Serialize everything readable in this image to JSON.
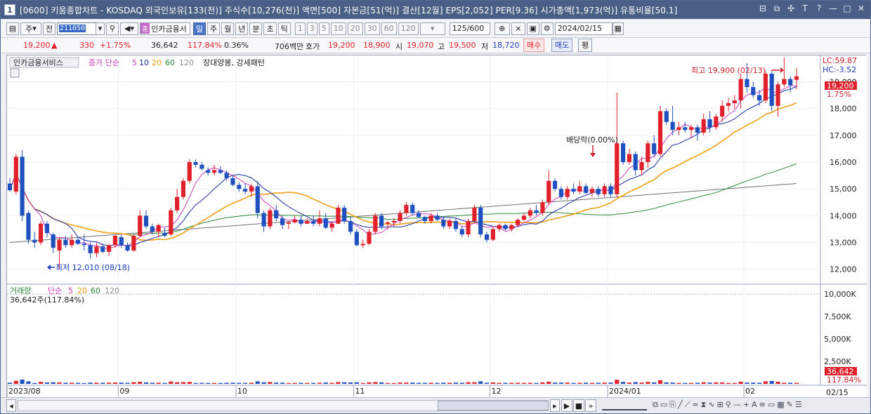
{
  "window": {
    "number": "1",
    "title": "[0600] 키움종합차트 - KOSDAQ 외국인보유[133(천)] 주식수[10,276(천)] 액면[500] 자본금[51(억)] 결산[12월] EPS[2,052] PER[9.36] 시가총액[1,973(억)] 유통비율[50.1]",
    "controls": [
      "⊟",
      "⧉",
      "✣",
      "T",
      "?",
      "—",
      "□",
      "✕"
    ]
  },
  "toolbar": {
    "type_select": "주",
    "prev_label": "전",
    "code": "211050",
    "stock_name": "인카금융서",
    "name_tag": "종",
    "periods": [
      "일",
      "주",
      "월",
      "년",
      "분",
      "초",
      "틱"
    ],
    "active_period": "일",
    "intervals": [
      "1",
      "3",
      "5",
      "10",
      "20",
      "30",
      "60",
      "120"
    ],
    "count": "125",
    "count_max": "/600",
    "date": "2024/02/15"
  },
  "quote": {
    "price": "19,200",
    "arrow": "▲",
    "change": "330",
    "change_pct": "+1.75%",
    "volume": "36,642",
    "vol_ratio": "117.84%",
    "turnover": "0.36%",
    "amount": "706백만",
    "ask_label": "호가",
    "ask": "19,200",
    "bid": "18,900",
    "open_label": "시",
    "open": "19,070",
    "high_label": "고",
    "high": "19,500",
    "low_label": "저",
    "low": "18,720",
    "buy": "매수",
    "sell": "매도",
    "eval": "평"
  },
  "price_pane": {
    "legend_name": "인카금융서비스",
    "legend_ma": "종가 단순",
    "ma_periods": [
      "5",
      "10",
      "20",
      "60",
      "120"
    ],
    "pattern": "장대양봉, 강세패턴",
    "lc": "LC:59.87",
    "hc": "HC:-3.52",
    "last_price": "19,200",
    "last_pct": "1.75%",
    "high_note": "최고 19,900 (02/13)",
    "low_note": "최저 12,010 (08/18)",
    "event_note": "배당락(0.00%)",
    "y_ticks": [
      "19,000",
      "18,000",
      "17,000",
      "16,000",
      "15,000",
      "14,000",
      "13,000",
      "12,000"
    ]
  },
  "volume_pane": {
    "legend_name": "거래량",
    "legend_ma": "단순",
    "ma_periods": [
      "5",
      "20",
      "60",
      "120"
    ],
    "summary": "36,642주(117.84%)",
    "y_ticks": [
      "10,000K",
      "7,500K",
      "5,000K",
      "2,500K"
    ],
    "last_volume": "36,642",
    "last_pct": "117.84%"
  },
  "x_labels": [
    "2023/08",
    "09",
    "10",
    "11",
    "12",
    "2024/01",
    "02"
  ],
  "x_end_label": "02/15",
  "colors": {
    "up": "#e0202a",
    "down": "#1e50c0",
    "ma5": "#d040c0",
    "ma10": "#1a2aa0",
    "ma20": "#f0a018",
    "ma60": "#2a8a3a",
    "ma120": "#707070"
  },
  "chart_data": {
    "type": "candlestick",
    "y_range": [
      11600,
      19850
    ],
    "candles": [
      {
        "d": "08/07",
        "o": 15200,
        "h": 15400,
        "l": 14900,
        "c": 14950
      },
      {
        "d": "08/08",
        "o": 14900,
        "h": 16300,
        "l": 14800,
        "c": 16200
      },
      {
        "d": "08/09",
        "o": 16200,
        "h": 16450,
        "l": 13800,
        "c": 14000
      },
      {
        "d": "08/10",
        "o": 14100,
        "h": 14200,
        "l": 12950,
        "c": 13100
      },
      {
        "d": "08/11",
        "o": 13100,
        "h": 13400,
        "l": 12800,
        "c": 13000
      },
      {
        "d": "08/14",
        "o": 13000,
        "h": 13800,
        "l": 12900,
        "c": 13700
      },
      {
        "d": "08/16",
        "o": 13700,
        "h": 13800,
        "l": 13200,
        "c": 13350
      },
      {
        "d": "08/17",
        "o": 13300,
        "h": 13350,
        "l": 12600,
        "c": 12800
      },
      {
        "d": "08/18",
        "o": 12700,
        "h": 13200,
        "l": 12010,
        "c": 13100
      },
      {
        "d": "08/21",
        "o": 13100,
        "h": 13250,
        "l": 12800,
        "c": 12900
      },
      {
        "d": "08/22",
        "o": 12900,
        "h": 13300,
        "l": 12800,
        "c": 13100
      },
      {
        "d": "08/23",
        "o": 13100,
        "h": 13200,
        "l": 12900,
        "c": 12950
      },
      {
        "d": "08/24",
        "o": 12950,
        "h": 13300,
        "l": 12700,
        "c": 12900
      },
      {
        "d": "08/25",
        "o": 12900,
        "h": 13000,
        "l": 12400,
        "c": 12600
      },
      {
        "d": "08/28",
        "o": 12600,
        "h": 13000,
        "l": 12450,
        "c": 12850
      },
      {
        "d": "08/29",
        "o": 12850,
        "h": 12950,
        "l": 12600,
        "c": 12650
      },
      {
        "d": "08/30",
        "o": 12650,
        "h": 12950,
        "l": 12500,
        "c": 12900
      },
      {
        "d": "08/31",
        "o": 12900,
        "h": 13300,
        "l": 12800,
        "c": 13250
      },
      {
        "d": "09/01",
        "o": 13200,
        "h": 13300,
        "l": 12800,
        "c": 12900
      },
      {
        "d": "09/04",
        "o": 12900,
        "h": 13000,
        "l": 12650,
        "c": 12700
      },
      {
        "d": "09/05",
        "o": 12700,
        "h": 13300,
        "l": 12650,
        "c": 13250
      },
      {
        "d": "09/06",
        "o": 13250,
        "h": 14200,
        "l": 13200,
        "c": 14000
      },
      {
        "d": "09/07",
        "o": 14000,
        "h": 14200,
        "l": 13500,
        "c": 13600
      },
      {
        "d": "09/08",
        "o": 13600,
        "h": 13700,
        "l": 13300,
        "c": 13400
      },
      {
        "d": "09/11",
        "o": 13400,
        "h": 13700,
        "l": 13200,
        "c": 13650
      },
      {
        "d": "09/12",
        "o": 13350,
        "h": 13550,
        "l": 13200,
        "c": 13250
      },
      {
        "d": "09/13",
        "o": 13300,
        "h": 14300,
        "l": 13250,
        "c": 14200
      },
      {
        "d": "09/14",
        "o": 14200,
        "h": 15000,
        "l": 14100,
        "c": 14700
      },
      {
        "d": "09/15",
        "o": 14700,
        "h": 15400,
        "l": 14600,
        "c": 15300
      },
      {
        "d": "09/18",
        "o": 15300,
        "h": 16100,
        "l": 15200,
        "c": 16000
      },
      {
        "d": "09/19",
        "o": 16000,
        "h": 16100,
        "l": 15800,
        "c": 15900
      },
      {
        "d": "09/20",
        "o": 15900,
        "h": 16000,
        "l": 15700,
        "c": 15750
      },
      {
        "d": "09/21",
        "o": 15700,
        "h": 15800,
        "l": 15500,
        "c": 15600
      },
      {
        "d": "09/22",
        "o": 15600,
        "h": 15900,
        "l": 15500,
        "c": 15700
      },
      {
        "d": "09/25",
        "o": 15700,
        "h": 15850,
        "l": 15550,
        "c": 15600
      },
      {
        "d": "09/26",
        "o": 15600,
        "h": 15700,
        "l": 15300,
        "c": 15400
      },
      {
        "d": "09/27",
        "o": 15400,
        "h": 15500,
        "l": 15100,
        "c": 15150
      },
      {
        "d": "10/04",
        "o": 15150,
        "h": 15250,
        "l": 14900,
        "c": 15000
      },
      {
        "d": "10/05",
        "o": 15000,
        "h": 15200,
        "l": 14800,
        "c": 14900
      },
      {
        "d": "10/06",
        "o": 14900,
        "h": 15200,
        "l": 14700,
        "c": 15100
      },
      {
        "d": "10/10",
        "o": 15100,
        "h": 15300,
        "l": 13900,
        "c": 14100
      },
      {
        "d": "10/11",
        "o": 14100,
        "h": 14200,
        "l": 13400,
        "c": 13600
      },
      {
        "d": "10/12",
        "o": 13600,
        "h": 14300,
        "l": 13500,
        "c": 14200
      },
      {
        "d": "10/13",
        "o": 14200,
        "h": 14400,
        "l": 13800,
        "c": 13900
      },
      {
        "d": "10/16",
        "o": 13900,
        "h": 14000,
        "l": 13500,
        "c": 13650
      },
      {
        "d": "10/17",
        "o": 13700,
        "h": 13800,
        "l": 13500,
        "c": 13750
      },
      {
        "d": "10/18",
        "o": 13750,
        "h": 14000,
        "l": 13700,
        "c": 13850
      },
      {
        "d": "10/19",
        "o": 13850,
        "h": 14000,
        "l": 13600,
        "c": 13700
      },
      {
        "d": "10/20",
        "o": 13700,
        "h": 13900,
        "l": 13700,
        "c": 13800
      },
      {
        "d": "10/23",
        "o": 13800,
        "h": 14000,
        "l": 13600,
        "c": 13700
      },
      {
        "d": "10/24",
        "o": 13700,
        "h": 14200,
        "l": 13600,
        "c": 13900
      },
      {
        "d": "10/25",
        "o": 13900,
        "h": 14100,
        "l": 13500,
        "c": 13550
      },
      {
        "d": "10/26",
        "o": 13550,
        "h": 13800,
        "l": 13400,
        "c": 13700
      },
      {
        "d": "10/27",
        "o": 13700,
        "h": 14400,
        "l": 13700,
        "c": 14300
      },
      {
        "d": "10/30",
        "o": 14300,
        "h": 14400,
        "l": 13700,
        "c": 13800
      },
      {
        "d": "10/31",
        "o": 13800,
        "h": 13950,
        "l": 13300,
        "c": 13400
      },
      {
        "d": "11/01",
        "o": 13400,
        "h": 13500,
        "l": 12850,
        "c": 12900
      },
      {
        "d": "11/02",
        "o": 12900,
        "h": 13100,
        "l": 12800,
        "c": 12950
      },
      {
        "d": "11/03",
        "o": 12950,
        "h": 13500,
        "l": 12900,
        "c": 13400
      },
      {
        "d": "11/06",
        "o": 13400,
        "h": 14100,
        "l": 13300,
        "c": 14000
      },
      {
        "d": "11/07",
        "o": 14000,
        "h": 14100,
        "l": 13500,
        "c": 13600
      },
      {
        "d": "11/08",
        "o": 13700,
        "h": 13800,
        "l": 13500,
        "c": 13750
      },
      {
        "d": "11/09",
        "o": 13750,
        "h": 13900,
        "l": 13600,
        "c": 13800
      },
      {
        "d": "11/10",
        "o": 13800,
        "h": 14200,
        "l": 13700,
        "c": 14100
      },
      {
        "d": "11/13",
        "o": 14100,
        "h": 14500,
        "l": 14000,
        "c": 14400
      },
      {
        "d": "11/14",
        "o": 14400,
        "h": 14500,
        "l": 14000,
        "c": 14100
      },
      {
        "d": "11/15",
        "o": 14100,
        "h": 14200,
        "l": 13900,
        "c": 13950
      },
      {
        "d": "11/16",
        "o": 13950,
        "h": 14000,
        "l": 13700,
        "c": 13800
      },
      {
        "d": "11/17",
        "o": 13800,
        "h": 14100,
        "l": 13700,
        "c": 14000
      },
      {
        "d": "11/20",
        "o": 14000,
        "h": 14100,
        "l": 13800,
        "c": 13850
      },
      {
        "d": "11/21",
        "o": 13850,
        "h": 13950,
        "l": 13500,
        "c": 13600
      },
      {
        "d": "11/22",
        "o": 13600,
        "h": 13900,
        "l": 13500,
        "c": 13800
      },
      {
        "d": "11/23",
        "o": 13800,
        "h": 13900,
        "l": 13400,
        "c": 13500
      },
      {
        "d": "11/24",
        "o": 13500,
        "h": 13600,
        "l": 13200,
        "c": 13300
      },
      {
        "d": "11/27",
        "o": 13300,
        "h": 13900,
        "l": 13200,
        "c": 13800
      },
      {
        "d": "11/28",
        "o": 13800,
        "h": 14400,
        "l": 13700,
        "c": 14300
      },
      {
        "d": "11/29",
        "o": 14300,
        "h": 14400,
        "l": 13200,
        "c": 13300
      },
      {
        "d": "11/30",
        "o": 13300,
        "h": 13400,
        "l": 13000,
        "c": 13100
      },
      {
        "d": "12/01",
        "o": 13100,
        "h": 13600,
        "l": 13050,
        "c": 13500
      },
      {
        "d": "12/04",
        "o": 13500,
        "h": 13700,
        "l": 13400,
        "c": 13650
      },
      {
        "d": "12/05",
        "o": 13650,
        "h": 13700,
        "l": 13450,
        "c": 13500
      },
      {
        "d": "12/06",
        "o": 13500,
        "h": 13700,
        "l": 13400,
        "c": 13650
      },
      {
        "d": "12/07",
        "o": 13650,
        "h": 13900,
        "l": 13600,
        "c": 13850
      },
      {
        "d": "12/08",
        "o": 13850,
        "h": 14100,
        "l": 13800,
        "c": 14000
      },
      {
        "d": "12/11",
        "o": 14000,
        "h": 14300,
        "l": 13900,
        "c": 14200
      },
      {
        "d": "12/12",
        "o": 14200,
        "h": 14400,
        "l": 14000,
        "c": 14100
      },
      {
        "d": "12/13",
        "o": 14100,
        "h": 14600,
        "l": 14000,
        "c": 14500
      },
      {
        "d": "12/14",
        "o": 14500,
        "h": 15700,
        "l": 14400,
        "c": 15300
      },
      {
        "d": "12/15",
        "o": 15300,
        "h": 15400,
        "l": 14900,
        "c": 15000
      },
      {
        "d": "12/18",
        "o": 15000,
        "h": 15100,
        "l": 14600,
        "c": 14700
      },
      {
        "d": "12/19",
        "o": 14700,
        "h": 15100,
        "l": 14600,
        "c": 15000
      },
      {
        "d": "12/20",
        "o": 15000,
        "h": 15200,
        "l": 14800,
        "c": 14900
      },
      {
        "d": "12/21",
        "o": 14900,
        "h": 15300,
        "l": 14800,
        "c": 15100
      },
      {
        "d": "12/22",
        "o": 15100,
        "h": 15200,
        "l": 14800,
        "c": 14850
      },
      {
        "d": "12/26",
        "o": 14850,
        "h": 15100,
        "l": 14700,
        "c": 15000
      },
      {
        "d": "12/27",
        "o": 15000,
        "h": 15100,
        "l": 14700,
        "c": 14800
      },
      {
        "d": "12/28",
        "o": 14800,
        "h": 15200,
        "l": 14700,
        "c": 15100
      },
      {
        "d": "01/02",
        "o": 15100,
        "h": 15200,
        "l": 14700,
        "c": 14800
      },
      {
        "d": "01/03",
        "o": 14800,
        "h": 18600,
        "l": 14700,
        "c": 16700
      },
      {
        "d": "01/04",
        "o": 16700,
        "h": 16800,
        "l": 15900,
        "c": 16000
      },
      {
        "d": "01/05",
        "o": 16000,
        "h": 16500,
        "l": 15900,
        "c": 16300
      },
      {
        "d": "01/08",
        "o": 16300,
        "h": 16400,
        "l": 15500,
        "c": 15700
      },
      {
        "d": "01/09",
        "o": 15700,
        "h": 16200,
        "l": 15500,
        "c": 16000
      },
      {
        "d": "01/10",
        "o": 16000,
        "h": 16800,
        "l": 15800,
        "c": 16700
      },
      {
        "d": "01/11",
        "o": 16700,
        "h": 17000,
        "l": 16200,
        "c": 16300
      },
      {
        "d": "01/12",
        "o": 16300,
        "h": 18100,
        "l": 16200,
        "c": 17900
      },
      {
        "d": "01/15",
        "o": 17900,
        "h": 18000,
        "l": 17400,
        "c": 17500
      },
      {
        "d": "01/16",
        "o": 17500,
        "h": 18100,
        "l": 17000,
        "c": 17200
      },
      {
        "d": "01/17",
        "o": 17200,
        "h": 17500,
        "l": 17000,
        "c": 17300
      },
      {
        "d": "01/18",
        "o": 17300,
        "h": 17500,
        "l": 17100,
        "c": 17200
      },
      {
        "d": "01/19",
        "o": 17200,
        "h": 17400,
        "l": 16900,
        "c": 17300
      },
      {
        "d": "01/22",
        "o": 17300,
        "h": 17400,
        "l": 16800,
        "c": 17100
      },
      {
        "d": "01/23",
        "o": 17100,
        "h": 17800,
        "l": 17000,
        "c": 17600
      },
      {
        "d": "01/24",
        "o": 17600,
        "h": 17900,
        "l": 17100,
        "c": 17300
      },
      {
        "d": "01/25",
        "o": 17300,
        "h": 17800,
        "l": 17200,
        "c": 17700
      },
      {
        "d": "01/26",
        "o": 17700,
        "h": 18300,
        "l": 17500,
        "c": 18100
      },
      {
        "d": "01/29",
        "o": 18100,
        "h": 18400,
        "l": 17900,
        "c": 18200
      },
      {
        "d": "01/30",
        "o": 18200,
        "h": 18500,
        "l": 18000,
        "c": 18300
      },
      {
        "d": "01/31",
        "o": 18300,
        "h": 19300,
        "l": 18000,
        "c": 19100
      },
      {
        "d": "02/01",
        "o": 19100,
        "h": 19700,
        "l": 18600,
        "c": 18800
      },
      {
        "d": "02/02",
        "o": 18800,
        "h": 19000,
        "l": 18400,
        "c": 18500
      },
      {
        "d": "02/05",
        "o": 18500,
        "h": 18700,
        "l": 18100,
        "c": 18300
      },
      {
        "d": "02/06",
        "o": 18300,
        "h": 19400,
        "l": 18200,
        "c": 19300
      },
      {
        "d": "02/07",
        "o": 19300,
        "h": 19400,
        "l": 17900,
        "c": 18100
      },
      {
        "d": "02/08",
        "o": 18100,
        "h": 19000,
        "l": 17700,
        "c": 18900
      },
      {
        "d": "02/13",
        "o": 18900,
        "h": 19900,
        "l": 18800,
        "c": 19100
      },
      {
        "d": "02/14",
        "o": 19100,
        "h": 19200,
        "l": 18600,
        "c": 18870
      },
      {
        "d": "02/15",
        "o": 19070,
        "h": 19500,
        "l": 18720,
        "c": 19200
      }
    ],
    "ma120": {
      "start": 13000,
      "end": 15200
    }
  }
}
